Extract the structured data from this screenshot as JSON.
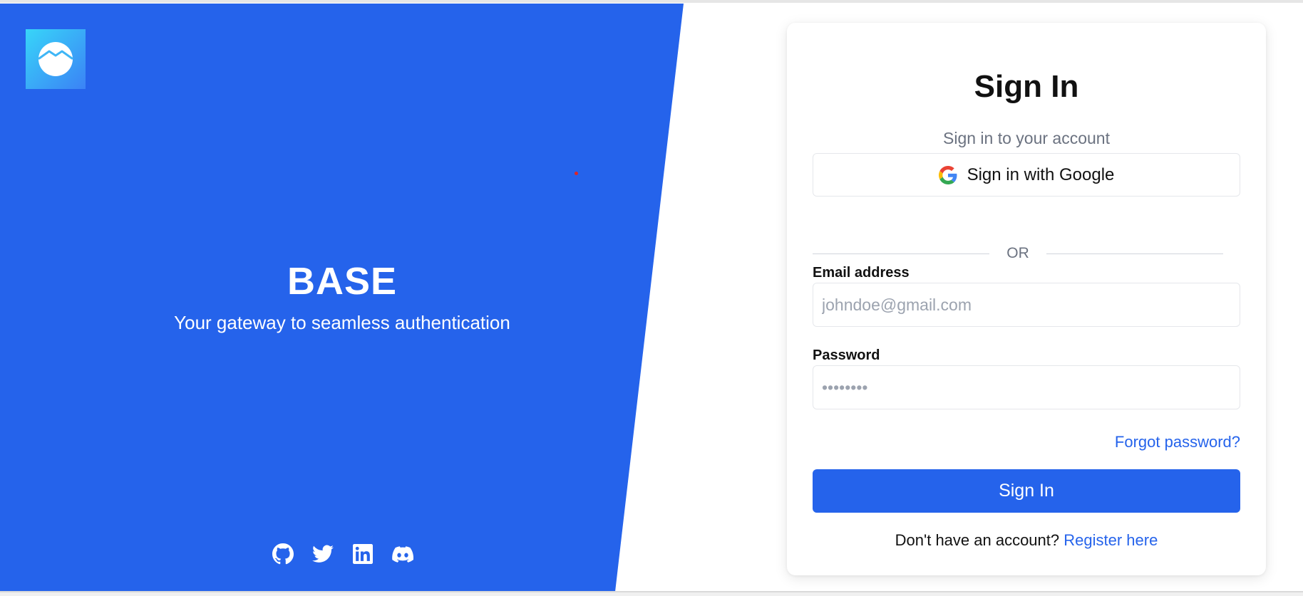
{
  "brand": {
    "title": "BASE",
    "tagline": "Your gateway to seamless authentication",
    "logo_icon": "wave-circle-logo-icon"
  },
  "socials": [
    {
      "icon": "github-icon"
    },
    {
      "icon": "twitter-icon"
    },
    {
      "icon": "linkedin-icon"
    },
    {
      "icon": "discord-icon"
    }
  ],
  "form": {
    "title": "Sign In",
    "subtitle": "Sign in to your account",
    "google_button_label": "Sign in with Google",
    "divider_text": "OR",
    "email_label": "Email address",
    "email_placeholder": "johndoe@gmail.com",
    "email_value": "",
    "password_label": "Password",
    "password_placeholder": "••••••••",
    "password_value": "",
    "forgot_password_label": "Forgot password?",
    "submit_label": "Sign In",
    "register_prompt": "Don't have an account?",
    "register_link_label": "Register here"
  },
  "colors": {
    "primary": "#2563eb",
    "panel_background": "#2563eb",
    "logo_gradient_start": "#38d5f8",
    "logo_gradient_end": "#3b82f6",
    "muted_text": "#6b7280"
  }
}
